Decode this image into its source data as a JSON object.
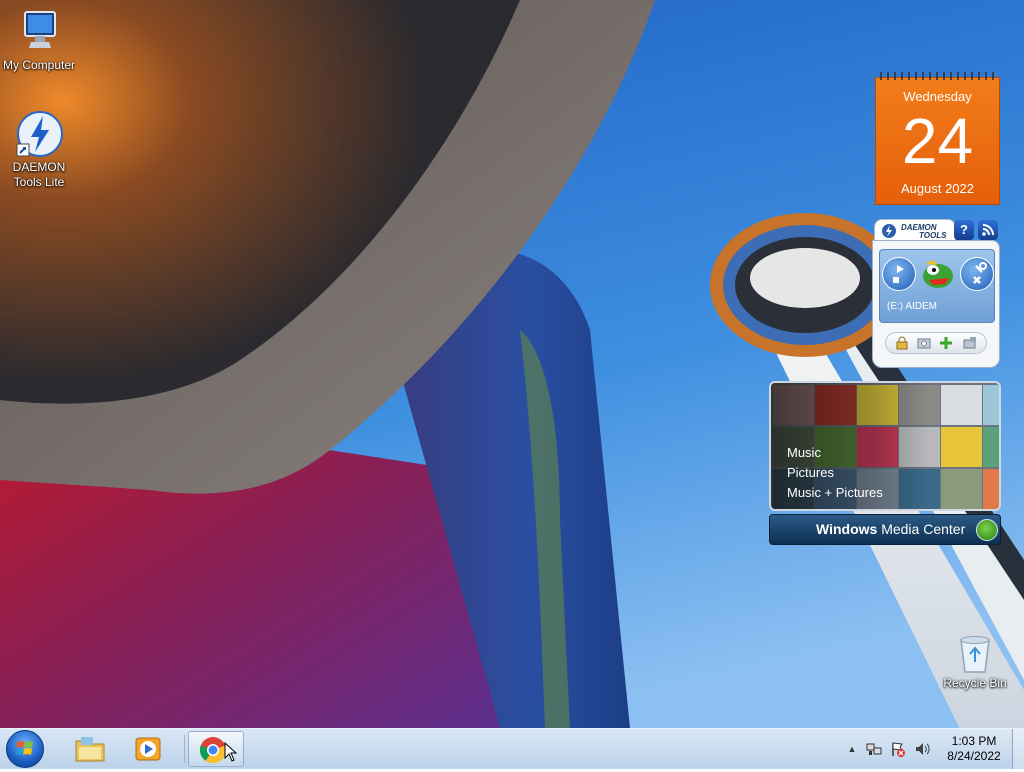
{
  "desktop": {
    "icons": [
      {
        "label": "My Computer",
        "icon": "computer-icon"
      },
      {
        "label": "DAEMON Tools Lite",
        "icon": "daemon-tools-icon"
      },
      {
        "label": "Recycle Bin",
        "icon": "recycle-bin-icon"
      }
    ]
  },
  "calendar_gadget": {
    "weekday": "Wednesday",
    "day": "24",
    "month_year": "August 2022"
  },
  "daemon_gadget": {
    "logo_line1": "DAEMON",
    "logo_line2": "TOOLS",
    "help_label": "?",
    "drive_label": "(E:) AIDEM"
  },
  "media_center_gadget": {
    "menu_items": [
      "Music",
      "Pictures",
      "Music + Pictures"
    ],
    "title_bold": "Windows",
    "title_rest": " Media Center"
  },
  "taskbar": {
    "pinned": [
      {
        "name": "file-explorer",
        "icon": "folder-icon"
      },
      {
        "name": "media-player",
        "icon": "media-player-icon"
      },
      {
        "name": "chrome",
        "icon": "chrome-icon",
        "active": true
      }
    ],
    "tray": {
      "show_hidden": "▲",
      "clock_time": "1:03 PM",
      "clock_date": "8/24/2022"
    }
  },
  "colors": {
    "calendar_orange": "#e8650f",
    "taskbar_bg": "#d2e1f0",
    "sky_blue": "#2f79d3"
  }
}
